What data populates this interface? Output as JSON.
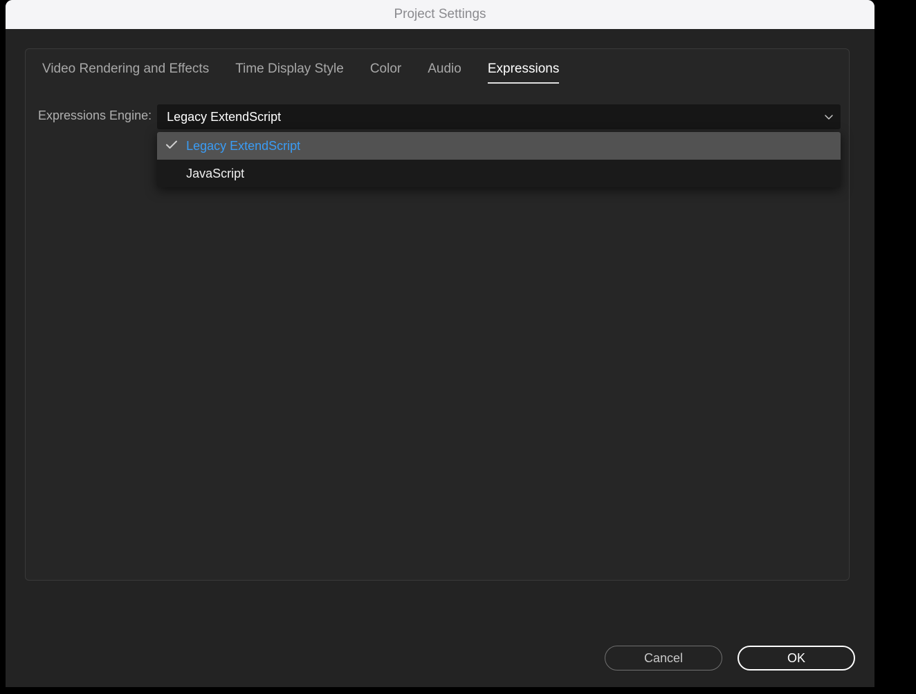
{
  "window": {
    "title": "Project Settings"
  },
  "tabs": [
    {
      "label": "Video Rendering and Effects",
      "active": false
    },
    {
      "label": "Time Display Style",
      "active": false
    },
    {
      "label": "Color",
      "active": false
    },
    {
      "label": "Audio",
      "active": false
    },
    {
      "label": "Expressions",
      "active": true
    }
  ],
  "field": {
    "label": "Expressions Engine:",
    "selected": "Legacy ExtendScript",
    "options": [
      {
        "label": "Legacy ExtendScript",
        "selected": true
      },
      {
        "label": "JavaScript",
        "selected": false
      }
    ]
  },
  "buttons": {
    "cancel": "Cancel",
    "ok": "OK"
  }
}
